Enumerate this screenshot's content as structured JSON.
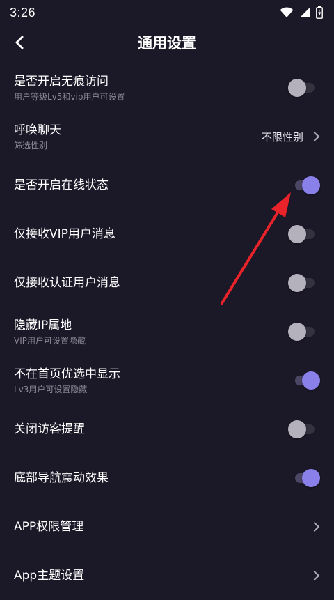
{
  "status_bar": {
    "time": "3:26"
  },
  "header": {
    "title": "通用设置"
  },
  "settings": [
    {
      "title": "是否开启无痕访问",
      "subtitle": "用户等级Lv5和vip用户可设置",
      "control": "toggle",
      "on": false
    },
    {
      "title": "呼唤聊天",
      "subtitle": "筛选性别",
      "control": "value",
      "value": "不限性别"
    },
    {
      "title": "是否开启在线状态",
      "control": "toggle",
      "on": true
    },
    {
      "title": "仅接收VIP用户消息",
      "control": "toggle",
      "on": false
    },
    {
      "title": "仅接收认证用户消息",
      "control": "toggle",
      "on": false
    },
    {
      "title": "隐藏IP属地",
      "subtitle": "VIP用户可设置隐藏",
      "control": "toggle",
      "on": false
    },
    {
      "title": "不在首页优选中显示",
      "subtitle": "Lv3用户可设置隐藏",
      "control": "toggle",
      "on": true
    },
    {
      "title": "关闭访客提醒",
      "control": "toggle",
      "on": false
    },
    {
      "title": "底部导航震动效果",
      "control": "toggle",
      "on": true
    },
    {
      "title": "APP权限管理",
      "control": "chevron"
    },
    {
      "title": "App主题设置",
      "control": "chevron"
    }
  ],
  "colors": {
    "background": "#1b1827",
    "accent": "#8a80ea",
    "annotation_arrow": "#e8232a"
  },
  "icons": [
    "wifi-icon",
    "cellular-signal-icon",
    "battery-charging-icon",
    "back-arrow-icon",
    "chevron-right-icon",
    "red-annotation-arrow"
  ]
}
